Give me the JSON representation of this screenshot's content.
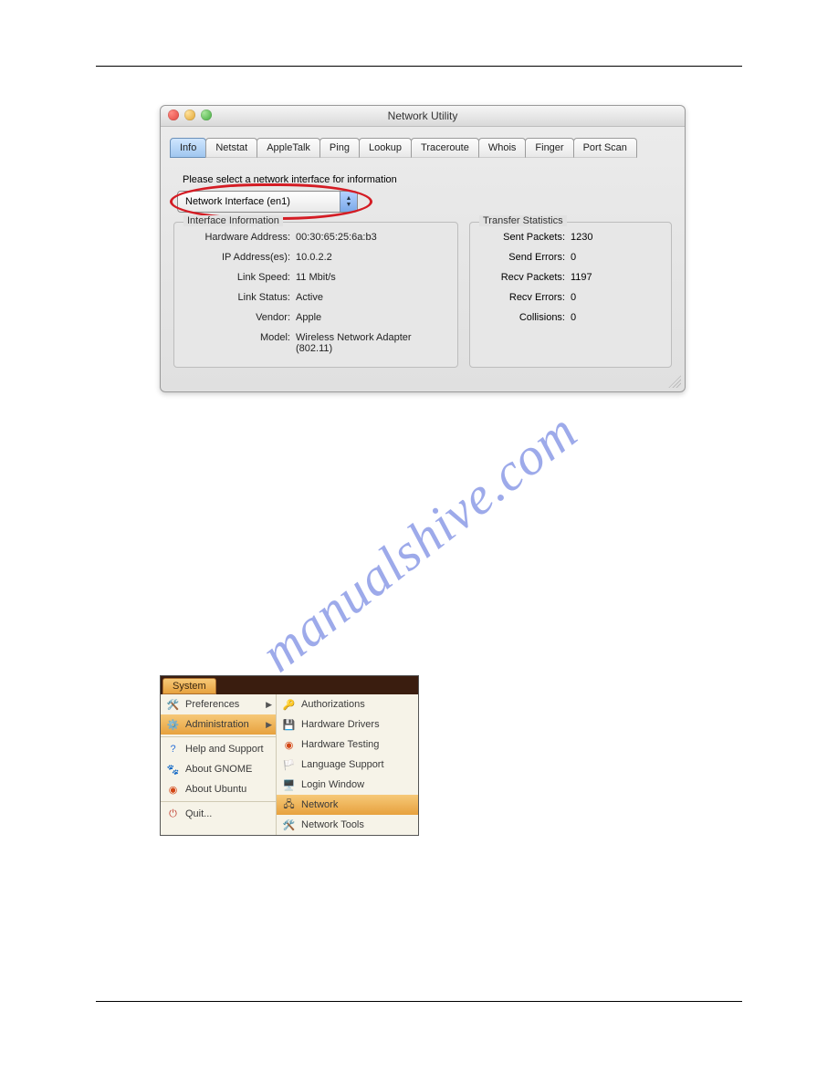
{
  "watermark": "manualshive.com",
  "mac": {
    "title": "Network Utility",
    "tabs": [
      "Info",
      "Netstat",
      "AppleTalk",
      "Ping",
      "Lookup",
      "Traceroute",
      "Whois",
      "Finger",
      "Port Scan"
    ],
    "active_tab": 0,
    "prompt": "Please select a network interface for information",
    "select_label": "Network Interface (en1)",
    "panel_left_title": "Interface Information",
    "panel_right_title": "Transfer Statistics",
    "info": {
      "hardware_address_label": "Hardware Address:",
      "hardware_address": "00:30:65:25:6a:b3",
      "ip_addresses_label": "IP Address(es):",
      "ip_addresses": "10.0.2.2",
      "link_speed_label": "Link Speed:",
      "link_speed": "11 Mbit/s",
      "link_status_label": "Link Status:",
      "link_status": "Active",
      "vendor_label": "Vendor:",
      "vendor": "Apple",
      "model_label": "Model:",
      "model": "Wireless Network Adapter (802.11)"
    },
    "stats": {
      "sent_packets_label": "Sent Packets:",
      "sent_packets": "1230",
      "send_errors_label": "Send Errors:",
      "send_errors": "0",
      "recv_packets_label": "Recv Packets:",
      "recv_packets": "1197",
      "recv_errors_label": "Recv Errors:",
      "recv_errors": "0",
      "collisions_label": "Collisions:",
      "collisions": "0"
    }
  },
  "ubuntu": {
    "system_tab": "System",
    "left": {
      "preferences": "Preferences",
      "administration": "Administration",
      "help": "Help and Support",
      "about_gnome": "About GNOME",
      "about_ubuntu": "About Ubuntu",
      "quit": "Quit..."
    },
    "right": {
      "authorizations": "Authorizations",
      "hardware_drivers": "Hardware Drivers",
      "hardware_testing": "Hardware Testing",
      "language_support": "Language Support",
      "login_window": "Login Window",
      "network": "Network",
      "network_tools": "Network Tools"
    }
  }
}
